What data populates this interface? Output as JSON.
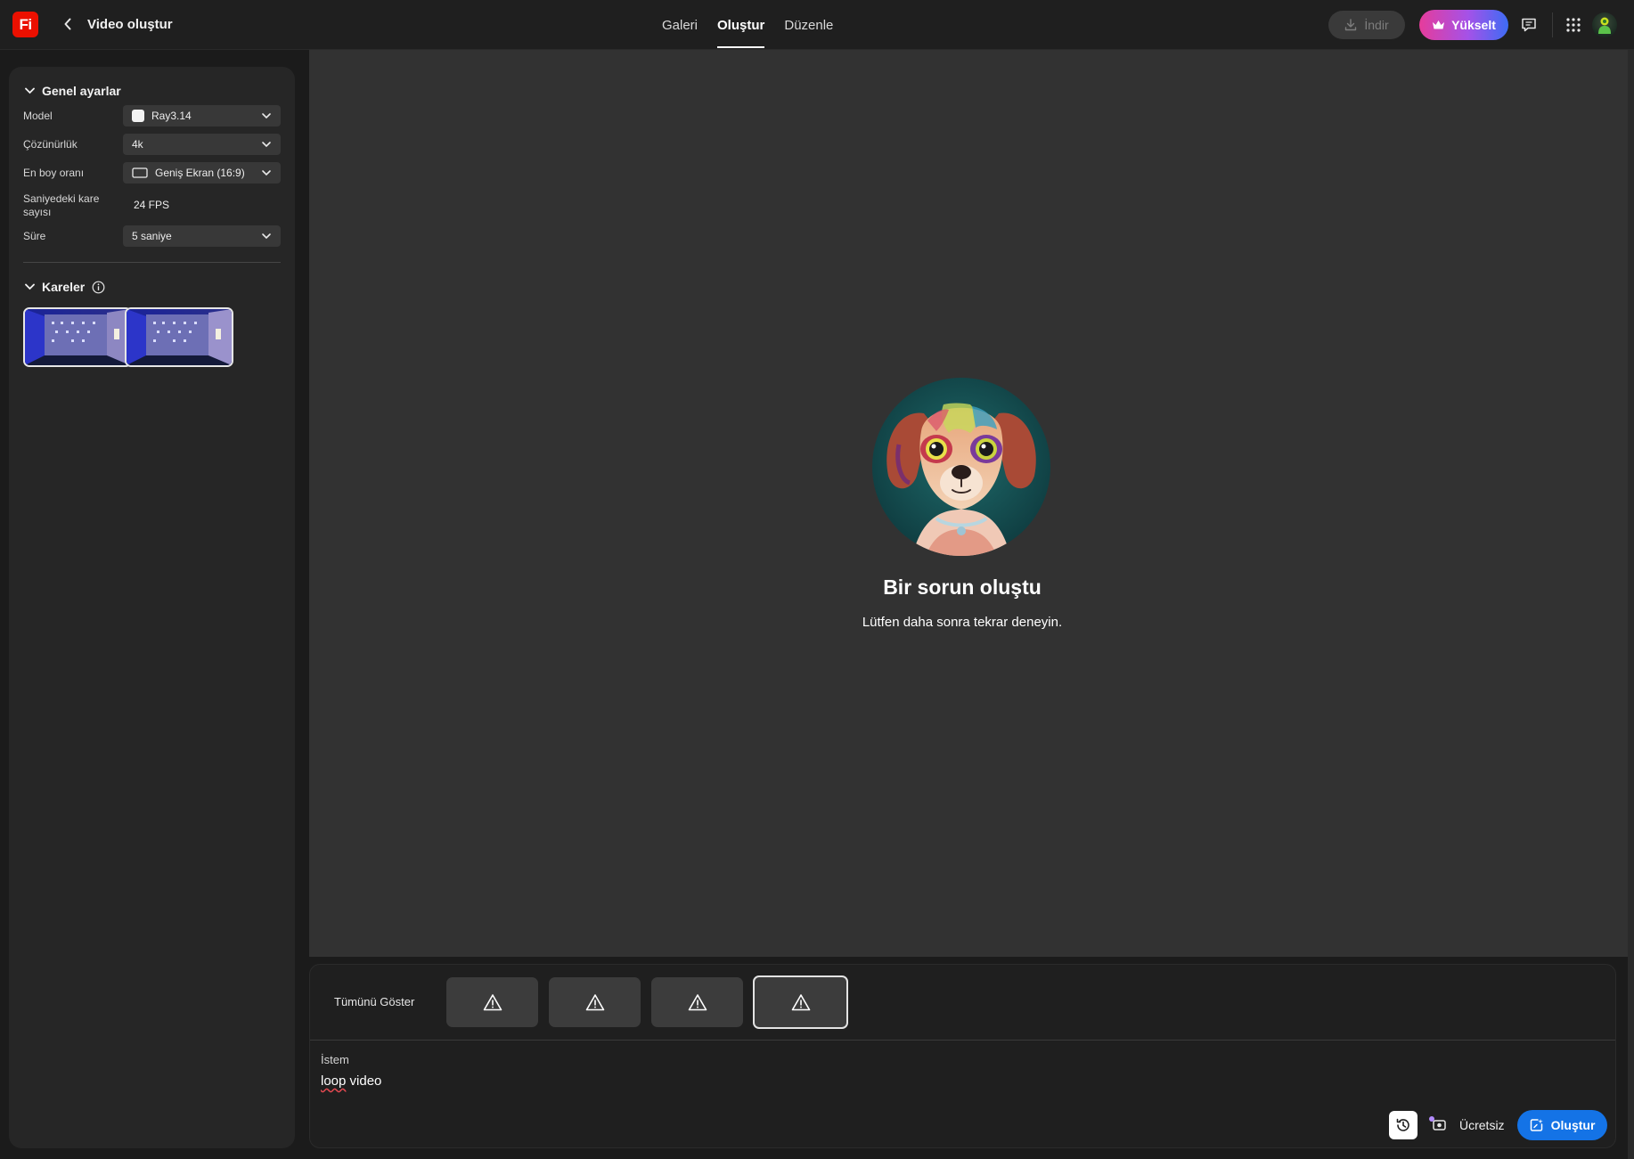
{
  "app": {
    "logo_text": "Fi",
    "page_title": "Video oluştur"
  },
  "nav": {
    "tabs": [
      {
        "label": "Galeri",
        "active": false
      },
      {
        "label": "Oluştur",
        "active": true
      },
      {
        "label": "Düzenle",
        "active": false
      }
    ]
  },
  "topbar": {
    "download_label": "İndir",
    "upgrade_label": "Yükselt"
  },
  "general_settings": {
    "title": "Genel ayarlar",
    "model_label": "Model",
    "model_value": "Ray3.14",
    "resolution_label": "Çözünürlük",
    "resolution_value": "4k",
    "aspect_label": "En boy oranı",
    "aspect_value": "Geniş Ekran (16:9)",
    "fps_label_line1": "Saniyedeki kare",
    "fps_label_line2": "sayısı",
    "fps_value": "24 FPS",
    "duration_label": "Süre",
    "duration_value": "5 saniye"
  },
  "frames": {
    "title": "Kareler"
  },
  "error": {
    "title": "Bir sorun oluştu",
    "subtitle": "Lütfen daha sonra tekrar deneyin."
  },
  "prompt_panel": {
    "show_all": "Tümünü Göster",
    "variant_count": 4,
    "selected_variant_index": 3,
    "prompt_label": "İstem",
    "prompt_word_misspelled": "loop",
    "prompt_rest": " video",
    "free_label": "Ücretsiz",
    "generate_label": "Oluştur"
  },
  "colors": {
    "accent_blue": "#1473e6",
    "brand_red": "#eb1000",
    "upgrade_gradient_start": "#e63c9b",
    "upgrade_gradient_end": "#3d6cf4"
  },
  "icons": [
    "chevron-left-icon",
    "download-icon",
    "crown-icon",
    "feedback-icon",
    "apps-grid-icon",
    "chevron-down-icon",
    "model-icon",
    "aspect-ratio-icon",
    "info-icon",
    "warning-icon",
    "history-icon",
    "style-reference-icon",
    "generate-icon"
  ]
}
